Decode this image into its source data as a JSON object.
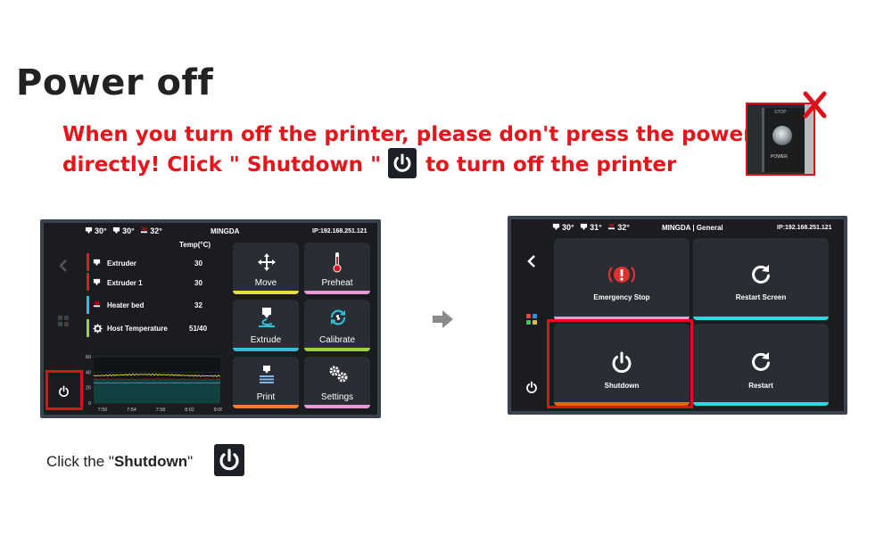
{
  "heading": "Power off",
  "warning": {
    "line1": "When you turn off the printer, please don't press the power",
    "line2_a": "directly! Click \" Shutdown \"",
    "line2_b": "to turn off the printer"
  },
  "device_photo": {
    "top_label": "STOP",
    "button_label": "POWER"
  },
  "screen_main": {
    "temps": [
      "30°",
      "30°",
      "32°"
    ],
    "model": "MINGDA",
    "ip": "IP:192.168.251.121",
    "temp_header": "Temp(°C)",
    "rows": [
      {
        "label": "Extruder",
        "value": "30",
        "color": "#d3202a"
      },
      {
        "label": "Extruder 1",
        "value": "30",
        "color": "#d3202a"
      },
      {
        "label": "Heater bed",
        "value": "32",
        "color": "#2fbfd8"
      },
      {
        "label": "Host Temperature",
        "value": "51/40",
        "color": "#9bd23a"
      }
    ],
    "chart": {
      "y_ticks": [
        "60",
        "40",
        "20",
        "0"
      ],
      "x_ticks": [
        "7:50",
        "7:54",
        "7:58",
        "8:02",
        "8:06"
      ],
      "series": [
        {
          "color": "#e6e03a",
          "level": 30
        },
        {
          "color": "#d3202a",
          "level": 30
        },
        {
          "color": "#2fbfd8",
          "level": 32
        }
      ]
    },
    "tiles": [
      {
        "label": "Move",
        "icon": "move-icon",
        "accent": "#e6e03a"
      },
      {
        "label": "Preheat",
        "icon": "thermometer-icon",
        "accent": "#e79ad6"
      },
      {
        "label": "Extrude",
        "icon": "extrude-icon",
        "accent": "#2fbfd8"
      },
      {
        "label": "Calibrate",
        "icon": "calibrate-icon",
        "accent": "#9bd23a"
      },
      {
        "label": "Print",
        "icon": "print-icon",
        "accent": "#f08030"
      },
      {
        "label": "Settings",
        "icon": "gear-icon",
        "accent": "#e79ad6"
      }
    ]
  },
  "screen_general": {
    "temps": [
      "30°",
      "31°",
      "32°"
    ],
    "model": "MINGDA | General",
    "ip": "IP:192.168.251.121",
    "buttons": [
      {
        "label": "Emergency Stop",
        "icon": "emergency-stop-icon",
        "accent": "#e79ad6"
      },
      {
        "label": "Restart Screen",
        "icon": "restart-icon",
        "accent": "#2fd8e0"
      },
      {
        "label": "Shutdown",
        "icon": "power-icon",
        "accent": "#f06018"
      },
      {
        "label": "Restart",
        "icon": "restart-icon",
        "accent": "#2fd8e0"
      }
    ]
  },
  "caption": {
    "prefix": "Click the \"",
    "bold": "Shutdown",
    "suffix": "\""
  },
  "colors": {
    "warning_red": "#e8141a",
    "highlight_red": "#e0101a",
    "screen_bg": "#1a1c20",
    "tile_bg": "#2a2d34"
  }
}
